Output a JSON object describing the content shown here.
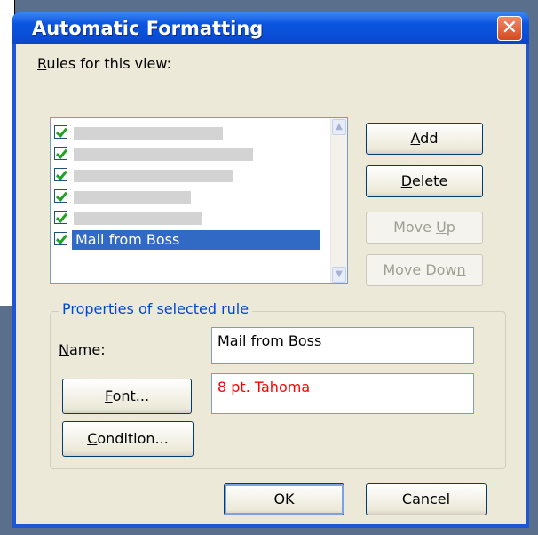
{
  "dialog": {
    "title": "Automatic Formatting",
    "close_symbol": "✕"
  },
  "rules": {
    "label": "Rules for this view:",
    "items": [
      {
        "checked": true,
        "label": "",
        "redacted": true
      },
      {
        "checked": true,
        "label": "",
        "redacted": true
      },
      {
        "checked": true,
        "label": "",
        "redacted": true
      },
      {
        "checked": true,
        "label": "",
        "redacted": true
      },
      {
        "checked": true,
        "label": "",
        "redacted": true
      },
      {
        "checked": true,
        "label": "Mail from Boss",
        "selected": true
      }
    ]
  },
  "buttons": {
    "add": "Add",
    "delete": "Delete",
    "move_up": "Move Up",
    "move_down": "Move Down",
    "ok": "OK",
    "cancel": "Cancel"
  },
  "properties": {
    "legend": "Properties of selected rule",
    "name_label": "Name:",
    "name_value": "Mail from Boss",
    "font_button": "Font...",
    "font_value": "8 pt. Tahoma",
    "font_value_color": "#ff0000",
    "condition_button": "Condition..."
  },
  "colors": {
    "title_bar": "#0a4ed6",
    "selection": "#316ac5",
    "dialog_bg": "#ece9d8",
    "legend_text": "#0046d5"
  }
}
